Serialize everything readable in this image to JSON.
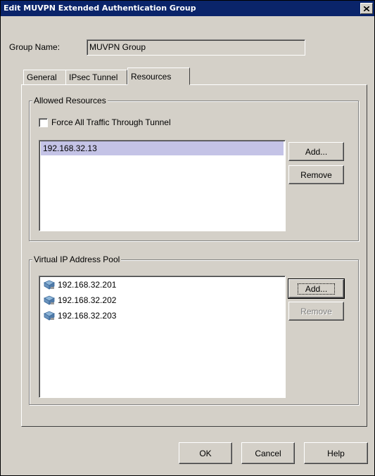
{
  "window": {
    "title": "Edit MUVPN Extended Authentication Group"
  },
  "group_name": {
    "label": "Group Name:",
    "value": "MUVPN Group"
  },
  "tabs": [
    {
      "label": "General",
      "active": false
    },
    {
      "label": "IPsec Tunnel",
      "active": false
    },
    {
      "label": "Resources",
      "active": true
    }
  ],
  "allowed_resources": {
    "title": "Allowed Resources",
    "force_label": "Force All Traffic Through Tunnel",
    "force_checked": false,
    "items": [
      "192.168.32.13"
    ],
    "add_label": "Add...",
    "remove_label": "Remove"
  },
  "vip_pool": {
    "title": "Virtual IP Address Pool",
    "items": [
      "192.168.32.201",
      "192.168.32.202",
      "192.168.32.203"
    ],
    "add_label": "Add...",
    "remove_label": "Remove",
    "remove_disabled": true
  },
  "buttons": {
    "ok": "OK",
    "cancel": "Cancel",
    "help": "Help"
  },
  "colors": {
    "titlebar": "#0a246a",
    "face": "#d4d0c8",
    "selection": "#c4c3e6"
  }
}
